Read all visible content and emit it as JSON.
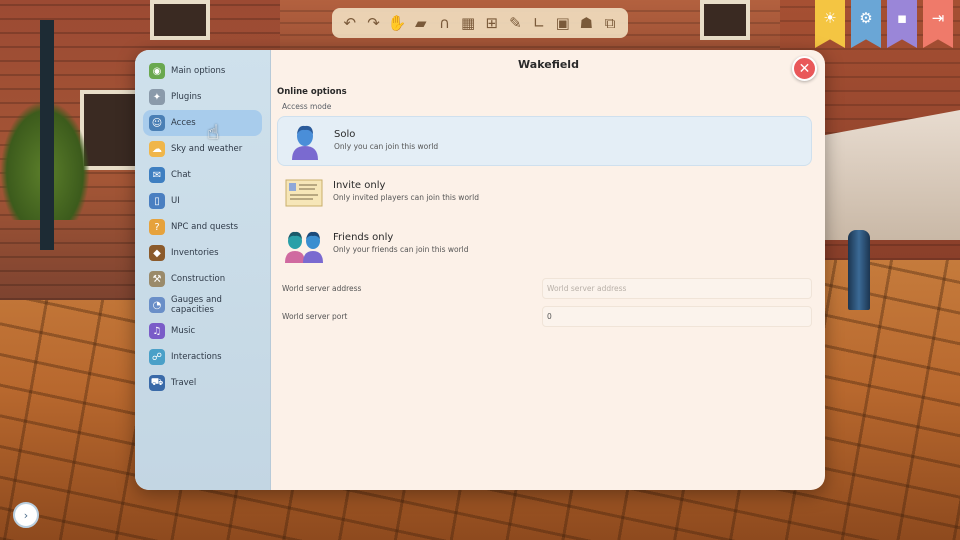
{
  "window": {
    "title": "Wakefield"
  },
  "toolbar": {
    "tools": [
      {
        "icon": "undo-icon",
        "glyph": "↶"
      },
      {
        "icon": "redo-icon",
        "glyph": "↷"
      },
      {
        "icon": "hand-icon",
        "glyph": "✋"
      },
      {
        "icon": "eraser-icon",
        "glyph": "▰"
      },
      {
        "icon": "magnet-icon",
        "glyph": "∩"
      },
      {
        "icon": "grid-icon",
        "glyph": "▦"
      },
      {
        "icon": "add-block-icon",
        "glyph": "⊞"
      },
      {
        "icon": "eyedropper-icon",
        "glyph": "✎"
      },
      {
        "icon": "ruler-icon",
        "glyph": "∟"
      },
      {
        "icon": "save-icon",
        "glyph": "▣"
      },
      {
        "icon": "ghost-icon",
        "glyph": "☗"
      },
      {
        "icon": "nodes-icon",
        "glyph": "⧉"
      }
    ]
  },
  "banners": [
    {
      "icon": "weather-sun-icon",
      "glyph": "☀",
      "color": "#f4c542"
    },
    {
      "icon": "world-settings-icon",
      "glyph": "⚙",
      "color": "#6aa6d6"
    },
    {
      "icon": "dice-icon",
      "glyph": "▪",
      "color": "#9a86d8"
    },
    {
      "icon": "exit-icon",
      "glyph": "⇥",
      "color": "#ef7a6a"
    }
  ],
  "sidebar": {
    "items": [
      {
        "label": "Main options",
        "icon": "main-options-icon",
        "glyph": "◉",
        "color": "#6aa84f",
        "active": false
      },
      {
        "label": "Plugins",
        "icon": "plugins-icon",
        "glyph": "✦",
        "color": "#8a9aaa",
        "active": false
      },
      {
        "label": "Acces",
        "icon": "access-icon",
        "glyph": "☺",
        "color": "#4a7fb5",
        "active": true
      },
      {
        "label": "Sky and weather",
        "icon": "sky-weather-icon",
        "glyph": "☁",
        "color": "#f0b64a",
        "active": false
      },
      {
        "label": "Chat",
        "icon": "chat-icon",
        "glyph": "✉",
        "color": "#3e7fc1",
        "active": false
      },
      {
        "label": "UI",
        "icon": "ui-icon",
        "glyph": "▯",
        "color": "#4a7fc1",
        "active": false
      },
      {
        "label": "NPC and quests",
        "icon": "npc-quests-icon",
        "glyph": "?",
        "color": "#e6a23c",
        "active": false
      },
      {
        "label": "Inventories",
        "icon": "inventories-icon",
        "glyph": "◆",
        "color": "#8b5a2b",
        "active": false
      },
      {
        "label": "Construction",
        "icon": "construction-icon",
        "glyph": "⚒",
        "color": "#9a8a6a",
        "active": false
      },
      {
        "label": "Gauges and capacities",
        "icon": "gauges-icon",
        "glyph": "◔",
        "color": "#6a8fc8",
        "active": false
      },
      {
        "label": "Music",
        "icon": "music-icon",
        "glyph": "♫",
        "color": "#7a5cc8",
        "active": false
      },
      {
        "label": "Interactions",
        "icon": "interactions-icon",
        "glyph": "☍",
        "color": "#4aa0c8",
        "active": false
      },
      {
        "label": "Travel",
        "icon": "travel-icon",
        "glyph": "⛟",
        "color": "#3a6aa8",
        "active": false
      }
    ]
  },
  "main": {
    "section_title": "Online options",
    "section_sub": "Access mode",
    "options": [
      {
        "label": "Solo",
        "desc": "Only you can join this world",
        "icon": "solo-avatar-icon",
        "selected": true
      },
      {
        "label": "Invite only",
        "desc": "Only invited players can join this world",
        "icon": "invitation-letter-icon",
        "selected": false
      },
      {
        "label": "Friends only",
        "desc": "Only your friends can join this world",
        "icon": "friends-avatars-icon",
        "selected": false
      }
    ],
    "fields": [
      {
        "label": "World server address",
        "value": "",
        "placeholder": "World server address"
      },
      {
        "label": "World server port",
        "value": "0",
        "placeholder": ""
      }
    ]
  },
  "corner_button": {
    "glyph": "›"
  },
  "close_button": {
    "glyph": "✕"
  }
}
